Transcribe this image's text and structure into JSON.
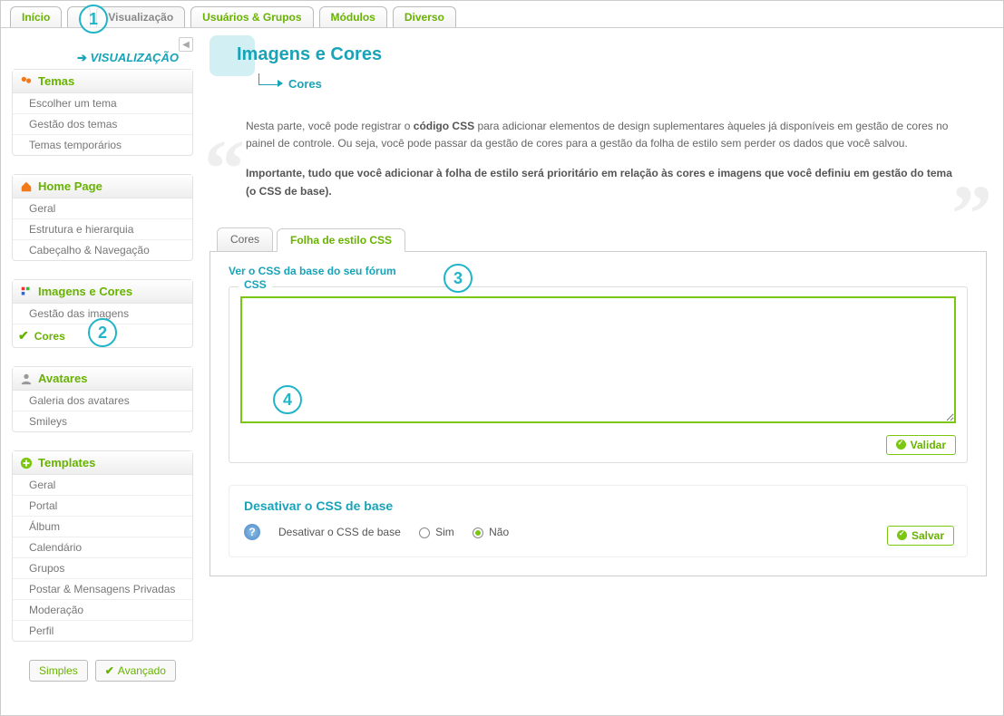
{
  "top_tabs": [
    "Início",
    "",
    "Visualização",
    "Usuários & Grupos",
    "Módulos",
    "Diverso"
  ],
  "top_tab_active_index": 2,
  "breadcrumb": {
    "label": "VISUALIZAÇÃO"
  },
  "sidebar": [
    {
      "icon": "people-icon",
      "title": "Temas",
      "items": [
        {
          "label": "Escolher um tema"
        },
        {
          "label": "Gestão dos temas"
        },
        {
          "label": "Temas temporários"
        }
      ]
    },
    {
      "icon": "home-icon",
      "title": "Home Page",
      "items": [
        {
          "label": "Geral"
        },
        {
          "label": "Estrutura e hierarquia"
        },
        {
          "label": "Cabeçalho & Navegação"
        }
      ]
    },
    {
      "icon": "palette-icon",
      "title": "Imagens e Cores",
      "items": [
        {
          "label": "Gestão das imagens"
        },
        {
          "label": "Cores",
          "selected": true
        }
      ]
    },
    {
      "icon": "avatar-icon",
      "title": "Avatares",
      "items": [
        {
          "label": "Galeria dos avatares"
        },
        {
          "label": "Smileys"
        }
      ]
    },
    {
      "icon": "plus-icon",
      "title": "Templates",
      "items": [
        {
          "label": "Geral"
        },
        {
          "label": "Portal"
        },
        {
          "label": "Álbum"
        },
        {
          "label": "Calendário"
        },
        {
          "label": "Grupos"
        },
        {
          "label": "Postar & Mensagens Privadas"
        },
        {
          "label": "Moderação"
        },
        {
          "label": "Perfil"
        }
      ]
    }
  ],
  "mode": {
    "simple": "Simples",
    "advanced": "Avançado"
  },
  "page_title": "Imagens e Cores",
  "page_sub": "Cores",
  "intro_parts": {
    "p1a": "Nesta parte, você pode registrar o ",
    "p1b": "código CSS",
    "p1c": " para adicionar elementos de design suplementares àqueles já disponíveis em gestão de cores no painel de controle. Ou seja, você pode passar da gestão de cores para a gestão da folha de estilo sem perder os dados que você salvou.",
    "p2": "Importante, tudo que você adicionar à folha de estilo será prioritário em relação às cores e imagens que você definiu em gestão do tema (o CSS de base)."
  },
  "sub_tabs": {
    "cores": "Cores",
    "css": "Folha de estilo CSS"
  },
  "css_panel": {
    "view_link": "Ver o CSS da base do seu fórum",
    "legend": "CSS",
    "value": "",
    "validate": "Validar"
  },
  "deactivate": {
    "title": "Desativar o CSS de base",
    "label": "Desativar o CSS de base",
    "yes": "Sim",
    "no": "Não",
    "selected": "no",
    "save": "Salvar"
  },
  "callouts": {
    "1": "1",
    "2": "2",
    "3": "3",
    "4": "4"
  }
}
